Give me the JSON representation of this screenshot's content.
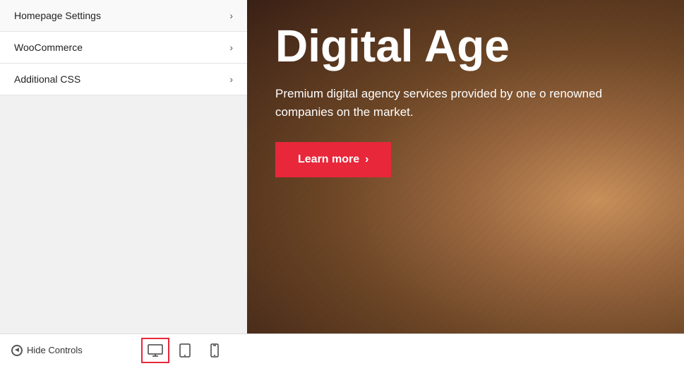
{
  "sidebar": {
    "items": [
      {
        "id": "homepage-settings",
        "label": "Homepage Settings"
      },
      {
        "id": "woocommerce",
        "label": "WooCommerce"
      },
      {
        "id": "additional-css",
        "label": "Additional CSS"
      }
    ]
  },
  "hero": {
    "title": "Digital Age",
    "subtitle": "Premium digital agency services provided by one o renowned companies on the market.",
    "button_label": "Learn more",
    "button_chevron": "›"
  },
  "bottom_bar": {
    "hide_controls_label": "Hide Controls",
    "device_desktop_icon": "🖥",
    "device_tablet_icon": "▭",
    "device_mobile_icon": "▯"
  },
  "colors": {
    "accent": "#e8273a",
    "sidebar_bg": "#f1f1f1",
    "hero_bg_dark": "#3a2015",
    "hero_text": "#ffffff"
  }
}
